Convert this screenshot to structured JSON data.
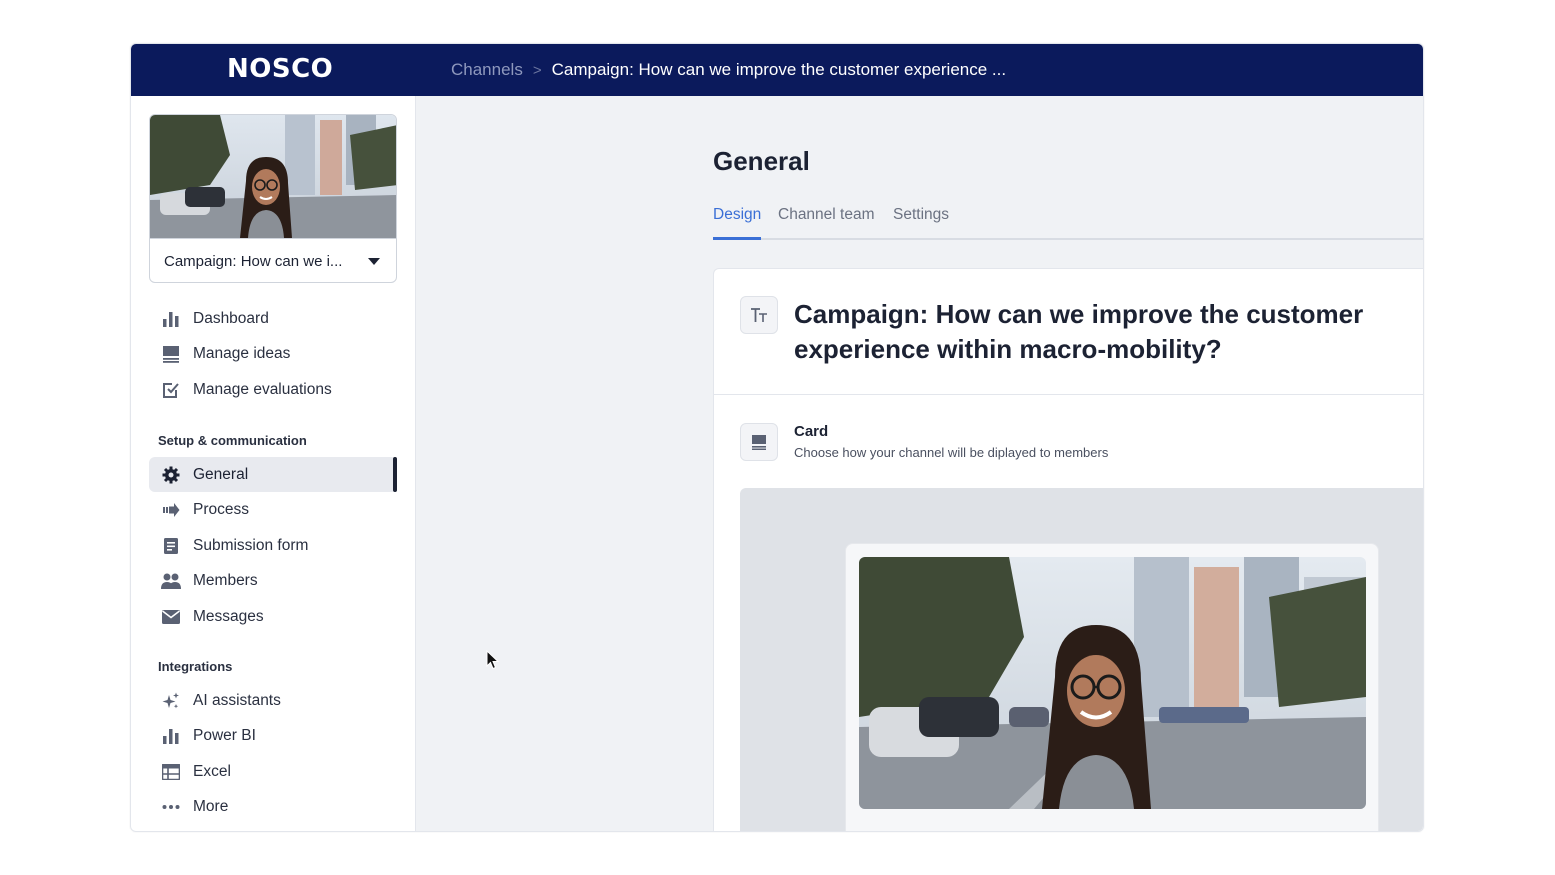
{
  "app": {
    "logo": "NOSCO"
  },
  "breadcrumb": {
    "parent": "Channels",
    "separator": ">",
    "current": "Campaign: How can we improve the customer experience ..."
  },
  "sidebar": {
    "channel_select": {
      "value": "Campaign: How can we i..."
    },
    "main_items": [
      {
        "label": "Dashboard",
        "icon": "bar-chart-icon"
      },
      {
        "label": "Manage ideas",
        "icon": "list-icon"
      },
      {
        "label": "Manage evaluations",
        "icon": "checkbox-icon"
      }
    ],
    "setup_section": "Setup & communication",
    "setup_items": [
      {
        "label": "General",
        "icon": "gear-icon",
        "active": true
      },
      {
        "label": "Process",
        "icon": "process-arrow-icon"
      },
      {
        "label": "Submission form",
        "icon": "form-icon"
      },
      {
        "label": "Members",
        "icon": "members-icon"
      },
      {
        "label": "Messages",
        "icon": "envelope-icon"
      }
    ],
    "integrations_section": "Integrations",
    "integration_items": [
      {
        "label": "AI assistants",
        "icon": "sparkle-icon"
      },
      {
        "label": "Power BI",
        "icon": "bar-chart-icon"
      },
      {
        "label": "Excel",
        "icon": "table-icon"
      },
      {
        "label": "More",
        "icon": "more-dots-icon"
      }
    ]
  },
  "main": {
    "page_title": "General",
    "tabs": [
      {
        "label": "Design",
        "active": true
      },
      {
        "label": "Channel team"
      },
      {
        "label": "Settings"
      }
    ],
    "title_field": {
      "value": "Campaign: How can we improve the customer experience within macro-mobility?"
    },
    "card_section": {
      "title": "Card",
      "description": "Choose how your channel will be diplayed to members"
    }
  },
  "colors": {
    "topbar": "#0b1a5c",
    "accent": "#3a6fd6",
    "active_bg": "#e8eaef"
  }
}
